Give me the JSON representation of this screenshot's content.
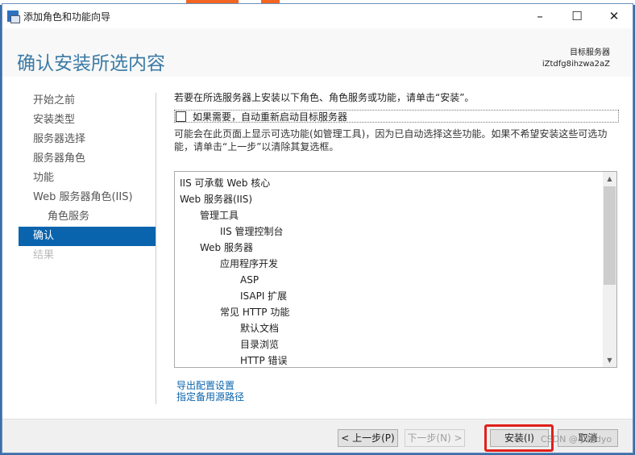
{
  "window": {
    "title": "添加角色和功能向导",
    "minimize": "–",
    "maximize": "☐",
    "close": "✕"
  },
  "header": {
    "title": "确认安装所选内容",
    "target_label": "目标服务器",
    "target_server": "iZtdfg8ihzwa2aZ"
  },
  "sidebar": {
    "items": [
      {
        "label": "开始之前",
        "state": "normal"
      },
      {
        "label": "安装类型",
        "state": "normal"
      },
      {
        "label": "服务器选择",
        "state": "normal"
      },
      {
        "label": "服务器角色",
        "state": "normal"
      },
      {
        "label": "功能",
        "state": "normal"
      },
      {
        "label": "Web 服务器角色(IIS)",
        "state": "normal"
      },
      {
        "label": "角色服务",
        "state": "sub"
      },
      {
        "label": "确认",
        "state": "active"
      },
      {
        "label": "结果",
        "state": "disabled"
      }
    ]
  },
  "main": {
    "intro": "若要在所选服务器上安装以下角色、角色服务或功能，请单击“安装”。",
    "restart_checkbox": "如果需要，自动重新启动目标服务器",
    "restart_checked": false,
    "note": "可能会在此页面上显示可选功能(如管理工具)，因为已自动选择这些功能。如果不希望安装这些可选功能，请单击“上一步”以清除其复选框。",
    "items": [
      {
        "label": "IIS 可承载 Web 核心",
        "level": 0
      },
      {
        "label": "Web 服务器(IIS)",
        "level": 0
      },
      {
        "label": "管理工具",
        "level": 1
      },
      {
        "label": "IIS 管理控制台",
        "level": 2
      },
      {
        "label": "Web 服务器",
        "level": 1
      },
      {
        "label": "应用程序开发",
        "level": 2
      },
      {
        "label": "ASP",
        "level": 3
      },
      {
        "label": "ISAPI 扩展",
        "level": 3
      },
      {
        "label": "常见 HTTP 功能",
        "level": 2
      },
      {
        "label": "默认文档",
        "level": 3
      },
      {
        "label": "目录浏览",
        "level": 3
      },
      {
        "label": "HTTP 错误",
        "level": 3
      }
    ],
    "export_link": "导出配置设置",
    "source_link": "指定备用源路径"
  },
  "footer": {
    "prev": "< 上一步(P)",
    "next": "下一步(N) >",
    "install": "安装(I)",
    "cancel": "取消",
    "watermark": "CSDN @小雄dyo"
  }
}
